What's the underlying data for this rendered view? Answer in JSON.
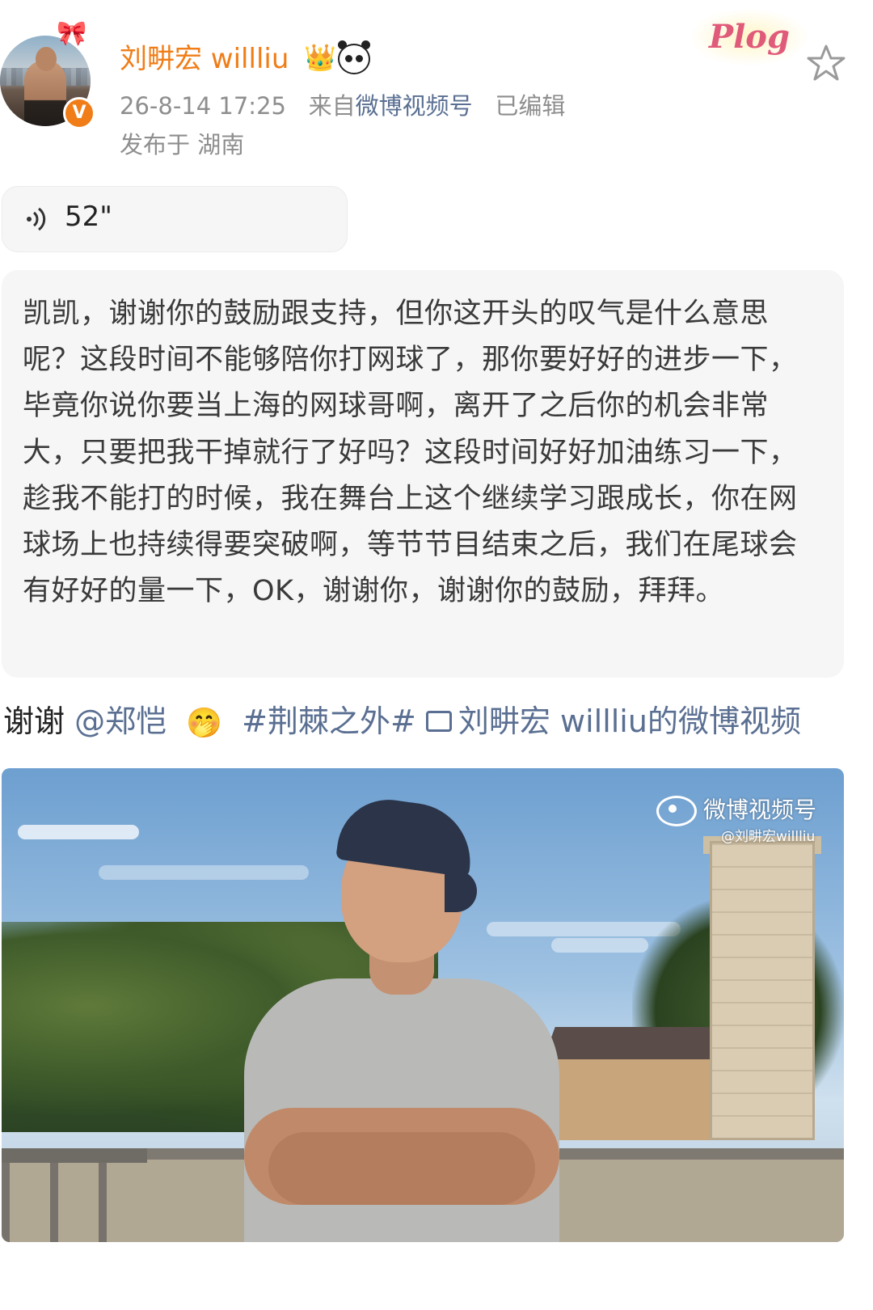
{
  "post": {
    "username": "刘畊宏 willliu",
    "meta_time": "26-8-14 17:25",
    "meta_from_prefix": "来自",
    "meta_source": "微博视频号",
    "meta_edited": "已编辑",
    "meta_location": "发布于 湖南",
    "badge_text": "Plog",
    "verified_mark": "V"
  },
  "voice": {
    "duration": "52\""
  },
  "transcript": {
    "text": "凯凯，谢谢你的鼓励跟支持，但你这开头的叹气是什么意思呢？这段时间不能够陪你打网球了，那你要好好的进步一下，毕竟你说你要当上海的网球哥啊，离开了之后你的机会非常大，只要把我干掉就行了好吗？这段时间好好加油练习一下，趁我不能打的时候，我在舞台上这个继续学习跟成长，你在网球场上也持续得要突破啊，等节节目结束之后，我们在尾球会有好好的量一下，OK，谢谢你，谢谢你的鼓励，拜拜。"
  },
  "caption": {
    "thanks": "谢谢",
    "mention": "@郑恺",
    "hashtag": "#荆棘之外#",
    "video_link": "刘畊宏 willliu的微博视频"
  },
  "video": {
    "watermark_title": "微博视频号",
    "watermark_handle": "@刘畊宏willliu"
  },
  "icons": {
    "star": "star-icon",
    "voice": "voice-wave-icon",
    "crown": "crown-icon",
    "panda": "panda-icon"
  },
  "colors": {
    "username": "#f07d17",
    "link": "#5a6f92",
    "meta": "#8e8e8e",
    "bubble_bg": "#f6f6f6"
  }
}
